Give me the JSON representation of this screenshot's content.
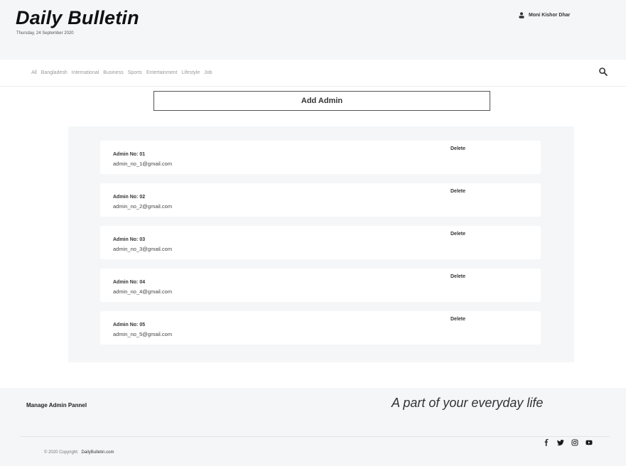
{
  "header": {
    "brand": "Daily Bulletin",
    "date": "Thursday, 24 September 2020",
    "user_name": "Moni Kishor Dhar"
  },
  "nav": {
    "items": [
      "All",
      "Bangladesh",
      "International",
      "Business",
      "Sports",
      "Entertainment",
      "Lifestyle",
      "Job"
    ]
  },
  "main": {
    "add_button_label": "Add Admin",
    "delete_label": "Delete",
    "admins": [
      {
        "name": "Admin No: 01",
        "email": "admin_no_1@gmail.com"
      },
      {
        "name": "Admin No: 02",
        "email": "admin_no_2@gmail.com"
      },
      {
        "name": "Admin No: 03",
        "email": "admin_no_3@gmail.com"
      },
      {
        "name": "Admin No: 04",
        "email": "admin_no_4@gmail.com"
      },
      {
        "name": "Admin No: 05",
        "email": "admin_no_5@gmail.com"
      }
    ]
  },
  "footer": {
    "manage_label": "Manage Admin Pannel",
    "tagline": "A part of your everyday life",
    "copyright": "© 2020 Copyright:",
    "site": "DailyBulletin.com",
    "social_icons": [
      "facebook-icon",
      "twitter-icon",
      "instagram-icon",
      "youtube-icon"
    ]
  }
}
